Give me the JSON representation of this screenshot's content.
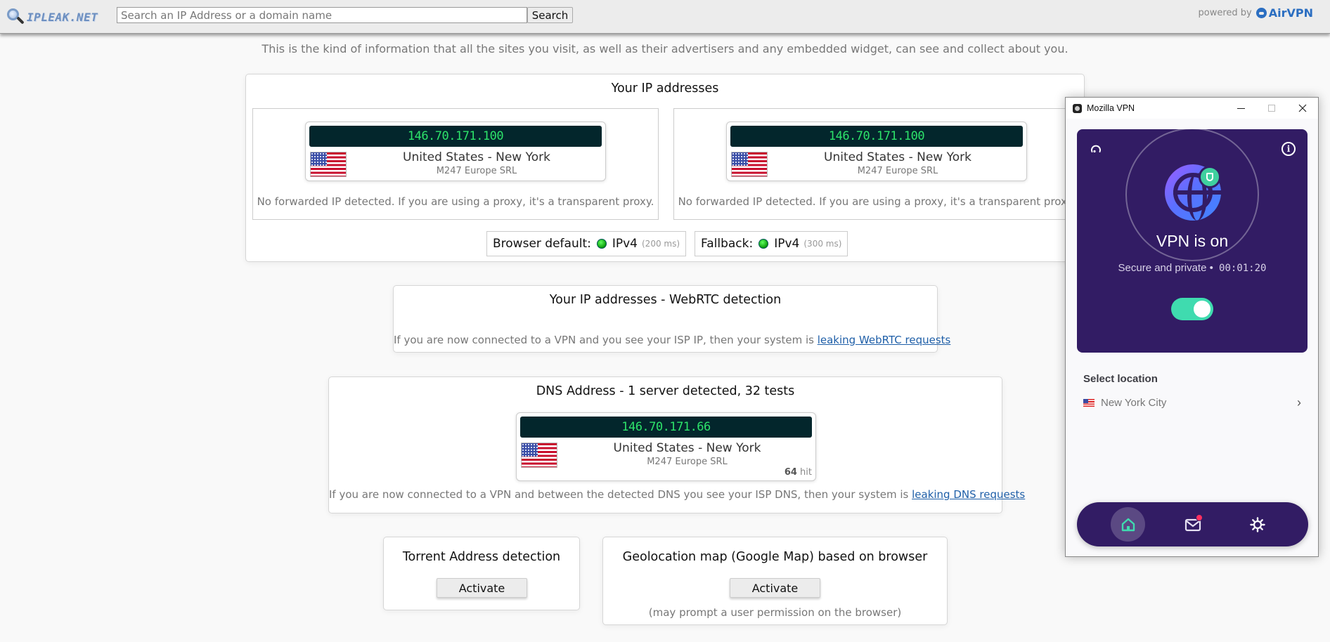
{
  "header": {
    "logo_text": "IPLEAK.NET",
    "search_placeholder": "Search an IP Address or a domain name",
    "search_button": "Search",
    "powered_by": "powered by",
    "powered_brand": "AirVPN"
  },
  "subtitle": "This is the kind of information that all the sites you visit, as well as their advertisers and any embedded widget, can see and collect about you.",
  "ip_section": {
    "title": "Your IP addresses",
    "entries": [
      {
        "ip": "146.70.171.100",
        "location": "United States - New York",
        "isp": "M247 Europe SRL",
        "note": "No forwarded IP detected. If you are using a proxy, it's a transparent proxy."
      },
      {
        "ip": "146.70.171.100",
        "location": "United States - New York",
        "isp": "M247 Europe SRL",
        "note": "No forwarded IP detected. If you are using a proxy, it's a transparent proxy."
      }
    ],
    "protocols": [
      {
        "label": "Browser default:",
        "status_color": "#17b317",
        "proto": "IPv4",
        "latency": "(200 ms)"
      },
      {
        "label": "Fallback:",
        "status_color": "#17b317",
        "proto": "IPv4",
        "latency": "(300 ms)"
      }
    ]
  },
  "webrtc": {
    "title": "Your IP addresses - WebRTC detection",
    "text": "If you are now connected to a VPN and you see your ISP IP, then your system is ",
    "link": "leaking WebRTC requests"
  },
  "dns": {
    "title": "DNS Address - 1 server detected, 32 tests",
    "entry": {
      "ip": "146.70.171.66",
      "location": "United States - New York",
      "isp": "M247 Europe SRL",
      "hits": "64",
      "hits_suffix": " hit"
    },
    "text": "If you are now connected to a VPN and between the detected DNS you see your ISP DNS, then your system is ",
    "link": "leaking DNS requests"
  },
  "torrent": {
    "title": "Torrent Address detection",
    "button": "Activate"
  },
  "geolocation": {
    "title": "Geolocation map (Google Map) based on browser",
    "button": "Activate",
    "note": "(may prompt a user permission on the browser)"
  },
  "vpn_window": {
    "title": "Mozilla VPN",
    "state": "VPN is on",
    "status_text": "Secure and private •",
    "timer": "00:01:20",
    "toggle_on": true,
    "select_location_label": "Select location",
    "location": "New York City",
    "nav": [
      "home",
      "messages",
      "settings"
    ],
    "has_unread_messages": true,
    "colors": {
      "primary": "#321c64",
      "accent": "#3fdbaf",
      "badge": "#ff3060"
    }
  }
}
